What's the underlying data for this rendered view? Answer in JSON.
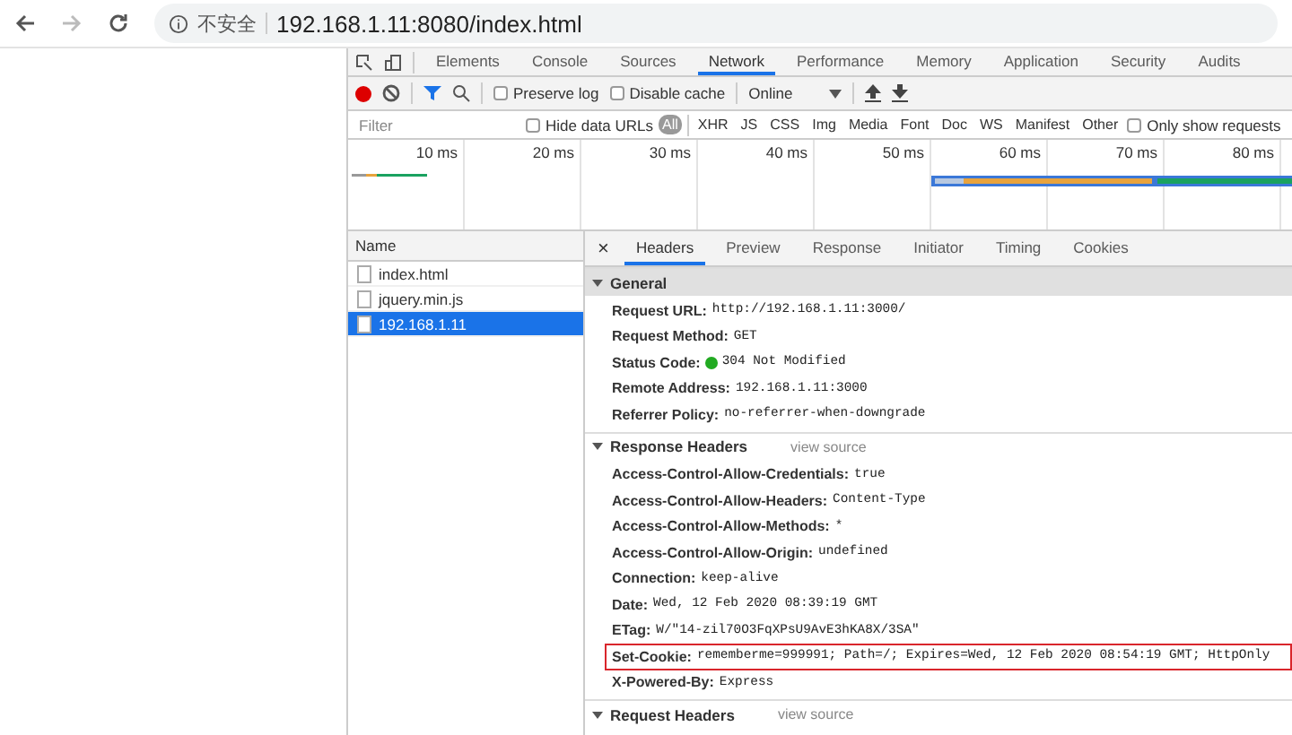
{
  "browser": {
    "security_label": "不安全",
    "url": "192.168.1.11:8080/index.html"
  },
  "devtools": {
    "tabs": [
      {
        "label": "Elements",
        "selected": false
      },
      {
        "label": "Console",
        "selected": false
      },
      {
        "label": "Sources",
        "selected": false
      },
      {
        "label": "Network",
        "selected": true
      },
      {
        "label": "Performance",
        "selected": false
      },
      {
        "label": "Memory",
        "selected": false
      },
      {
        "label": "Application",
        "selected": false
      },
      {
        "label": "Security",
        "selected": false
      },
      {
        "label": "Audits",
        "selected": false
      }
    ],
    "toolbar": {
      "recording": true,
      "preserve_log": {
        "label": "Preserve log",
        "checked": false
      },
      "disable_cache": {
        "label": "Disable cache",
        "checked": false
      },
      "throttling": "Online"
    },
    "filter": {
      "placeholder": "Filter",
      "hide_data_urls": {
        "label": "Hide data URLs",
        "checked": false
      },
      "types": [
        {
          "label": "All",
          "selected": true
        },
        {
          "label": "XHR",
          "selected": false
        },
        {
          "label": "JS",
          "selected": false
        },
        {
          "label": "CSS",
          "selected": false
        },
        {
          "label": "Img",
          "selected": false
        },
        {
          "label": "Media",
          "selected": false
        },
        {
          "label": "Font",
          "selected": false
        },
        {
          "label": "Doc",
          "selected": false
        },
        {
          "label": "WS",
          "selected": false
        },
        {
          "label": "Manifest",
          "selected": false
        },
        {
          "label": "Other",
          "selected": false
        }
      ],
      "only_show": {
        "label": "Only show requests",
        "checked": false
      }
    },
    "timeline": {
      "ticks": [
        "10 ms",
        "20 ms",
        "30 ms",
        "40 ms",
        "50 ms",
        "60 ms",
        "70 ms",
        "80 ms"
      ]
    },
    "requests": {
      "column": "Name",
      "items": [
        {
          "name": "index.html",
          "selected": false
        },
        {
          "name": "jquery.min.js",
          "selected": false
        },
        {
          "name": "192.168.1.11",
          "selected": true
        }
      ]
    },
    "detail": {
      "close": "×",
      "tabs": [
        {
          "label": "Headers",
          "selected": true
        },
        {
          "label": "Preview",
          "selected": false
        },
        {
          "label": "Response",
          "selected": false
        },
        {
          "label": "Initiator",
          "selected": false
        },
        {
          "label": "Timing",
          "selected": false
        },
        {
          "label": "Cookies",
          "selected": false
        }
      ],
      "sections": [
        {
          "title": "General",
          "expanded": true,
          "shaded": true,
          "items": [
            {
              "kind": "plain",
              "key": "Request URL:",
              "value": "http://192.168.1.11:3000/",
              "highlighted": false
            },
            {
              "kind": "plain",
              "key": "Request Method:",
              "value": "GET",
              "highlighted": false
            },
            {
              "kind": "status",
              "key": "Status Code:",
              "value": "304 Not Modified",
              "highlighted": false
            },
            {
              "kind": "plain",
              "key": "Remote Address:",
              "value": "192.168.1.11:3000",
              "highlighted": false
            },
            {
              "kind": "plain",
              "key": "Referrer Policy:",
              "value": "no-referrer-when-downgrade",
              "highlighted": false
            }
          ]
        },
        {
          "title": "Response Headers",
          "link": "view source",
          "expanded": true,
          "shaded": false,
          "items": [
            {
              "key": "Access-Control-Allow-Credentials:",
              "value": "true",
              "highlighted": false
            },
            {
              "key": "Access-Control-Allow-Headers:",
              "value": "Content-Type",
              "highlighted": false
            },
            {
              "key": "Access-Control-Allow-Methods:",
              "value": "*",
              "highlighted": false
            },
            {
              "key": "Access-Control-Allow-Origin:",
              "value": "undefined",
              "highlighted": false
            },
            {
              "key": "Connection:",
              "value": "keep-alive",
              "highlighted": false
            },
            {
              "key": "Date:",
              "value": "Wed, 12 Feb 2020 08:39:19 GMT",
              "highlighted": false
            },
            {
              "key": "ETag:",
              "value": "W/\"14-zil70O3FqXPsU9AvE3hKA8X/3SA\"",
              "highlighted": false
            },
            {
              "key": "Set-Cookie:",
              "value": "rememberme=999991; Path=/; Expires=Wed, 12 Feb 2020 08:54:19 GMT; HttpOnly",
              "highlighted": true
            },
            {
              "key": "X-Powered-By:",
              "value": "Express",
              "highlighted": false
            }
          ]
        },
        {
          "title": "Request Headers",
          "link": "view source",
          "expanded": true,
          "shaded": false
        }
      ]
    }
  }
}
